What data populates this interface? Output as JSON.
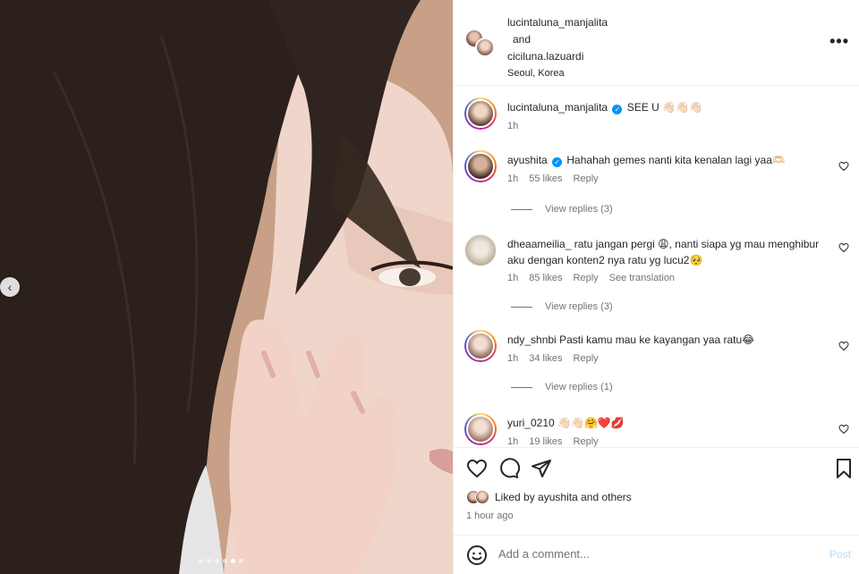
{
  "header": {
    "user1": "lucintaluna_manjalita",
    "conjunction": "and",
    "user2": "ciciluna.lazuardi",
    "location": "Seoul, Korea",
    "more_icon": "more-horizontal-icon"
  },
  "caption": {
    "username": "lucintaluna_manjalita",
    "text": "SEE U 👋🏻👋🏻👋🏻",
    "time": "1h"
  },
  "comments": [
    {
      "username": "ayushita",
      "verified": true,
      "text": "Hahahah gemes nanti kita kenalan lagi yaa🫶🏻",
      "time": "1h",
      "likes": "55 likes",
      "reply": "Reply",
      "view_replies": "View replies (3)"
    },
    {
      "username": "dheaameilia_",
      "text": "ratu jangan pergi 😩, nanti siapa yg mau menghibur aku dengan konten2 nya ratu yg lucu2🥺",
      "time": "1h",
      "likes": "85 likes",
      "reply": "Reply",
      "see_translation": "See translation",
      "view_replies": "View replies (3)"
    },
    {
      "username": "ndy_shnbi",
      "text": "Pasti kamu mau ke kayangan yaa ratu😂",
      "time": "1h",
      "likes": "34 likes",
      "reply": "Reply",
      "view_replies": "View replies (1)"
    },
    {
      "username": "yuri_0210",
      "text": "👋🏻👋🏻🤗❤️💋",
      "time": "1h",
      "likes": "19 likes",
      "reply": "Reply"
    }
  ],
  "actions": {
    "liked_prefix": "Liked by",
    "liked_user": "ayushita",
    "liked_suffix": "and others",
    "time_ago": "1 hour ago"
  },
  "composer": {
    "placeholder": "Add a comment...",
    "post_label": "Post"
  },
  "carousel": {
    "total": 6,
    "active_index": 4
  },
  "colors": {
    "verified": "#0095f6",
    "muted": "#737373",
    "post_disabled": "#b3dbff"
  }
}
